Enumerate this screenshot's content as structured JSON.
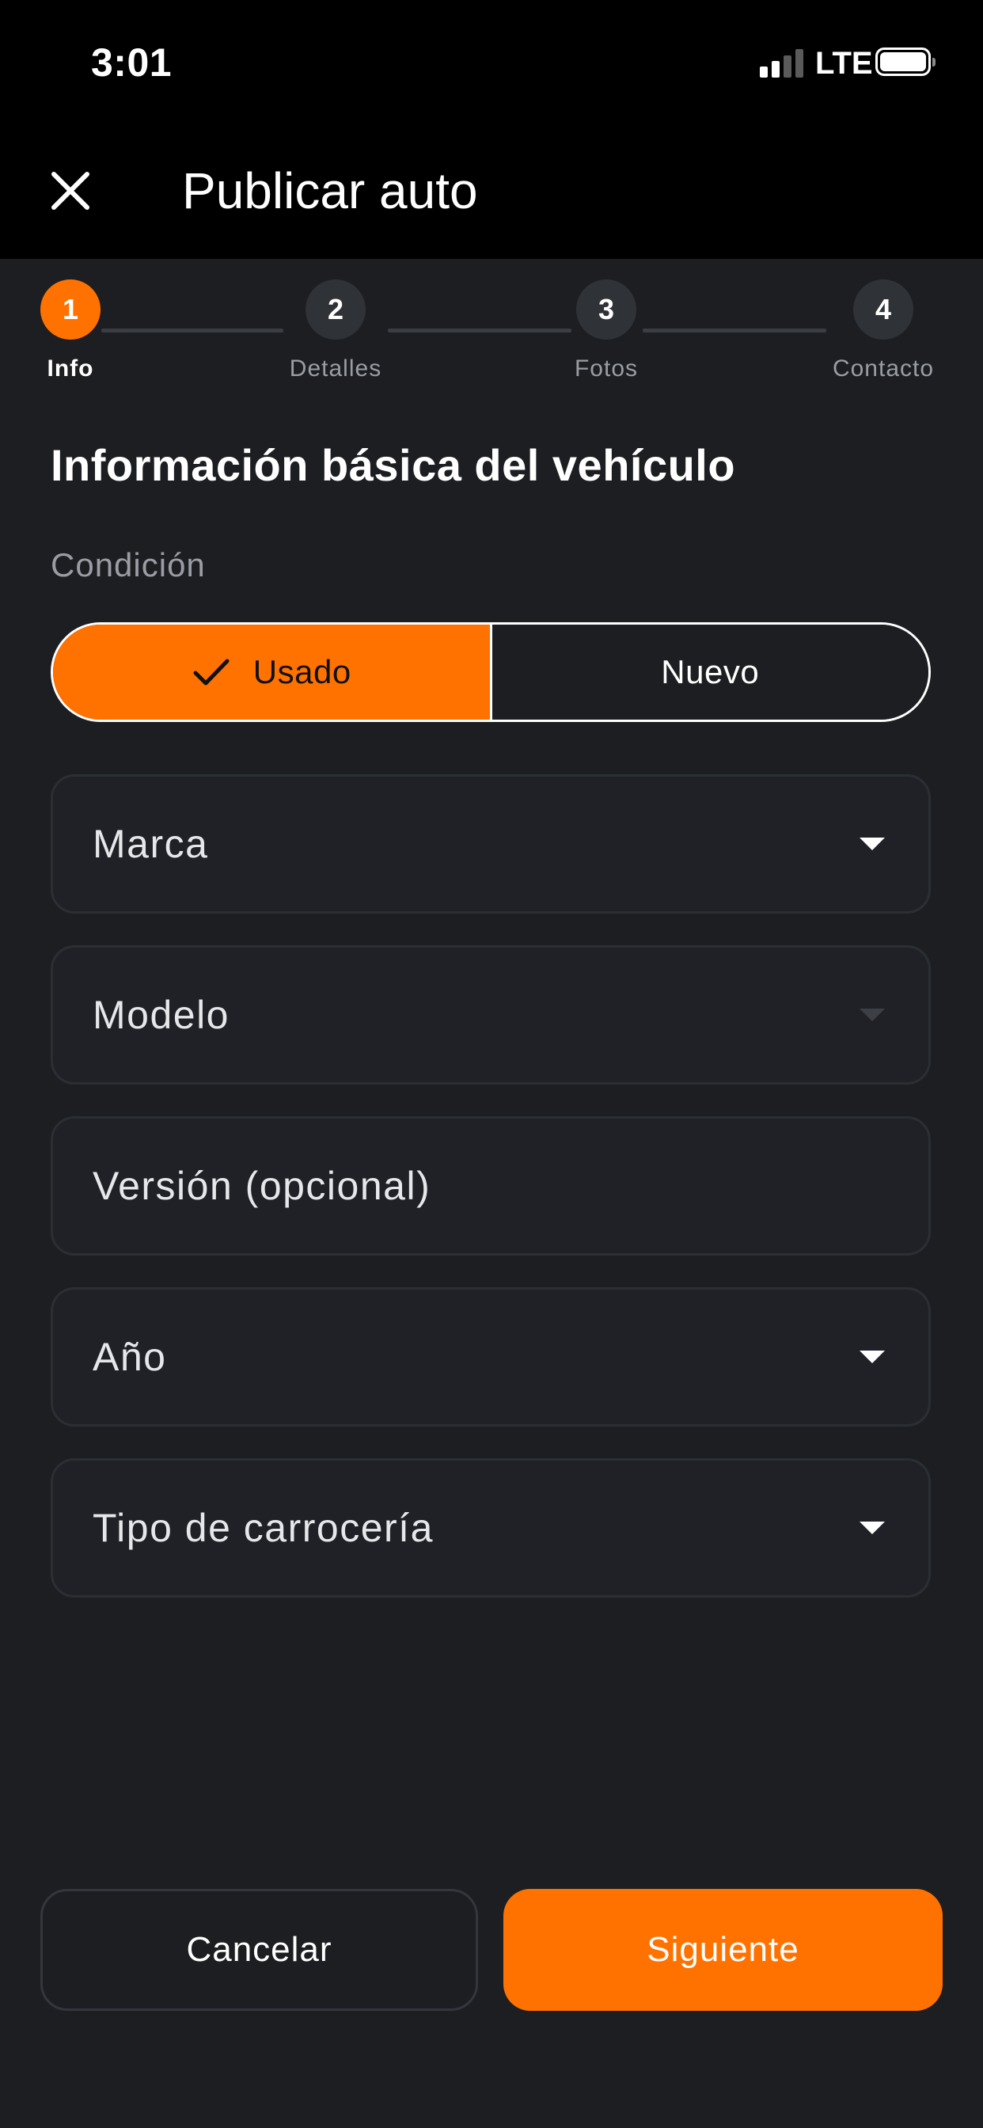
{
  "status_bar": {
    "time": "3:01",
    "network": "LTE",
    "icons": [
      "signal-icon",
      "battery-icon"
    ]
  },
  "header": {
    "title": "Publicar auto",
    "close_icon": "close-icon"
  },
  "stepper": {
    "current_step": 1,
    "steps": [
      {
        "number": "1",
        "label": "Info"
      },
      {
        "number": "2",
        "label": "Detalles"
      },
      {
        "number": "3",
        "label": "Fotos"
      },
      {
        "number": "4",
        "label": "Contacto"
      }
    ]
  },
  "form": {
    "section_title": "Información básica del vehículo",
    "condition": {
      "label": "Condición",
      "options": [
        "Usado",
        "Nuevo"
      ],
      "selected": "Usado"
    },
    "fields": [
      {
        "label": "Marca",
        "type": "dropdown",
        "enabled": true
      },
      {
        "label": "Modelo",
        "type": "dropdown",
        "enabled": false
      },
      {
        "label": "Versión (opcional)",
        "type": "text"
      },
      {
        "label": "Año",
        "type": "dropdown",
        "enabled": true
      },
      {
        "label": "Tipo de carrocería",
        "type": "dropdown",
        "enabled": true
      }
    ]
  },
  "actions": {
    "cancel_label": "Cancelar",
    "next_label": "Siguiente"
  },
  "colors": {
    "accent": "#ff7200",
    "background": "#1c1e22",
    "header_background": "#000000",
    "field_background": "#1f2126",
    "muted_text": "#9a9da3"
  }
}
